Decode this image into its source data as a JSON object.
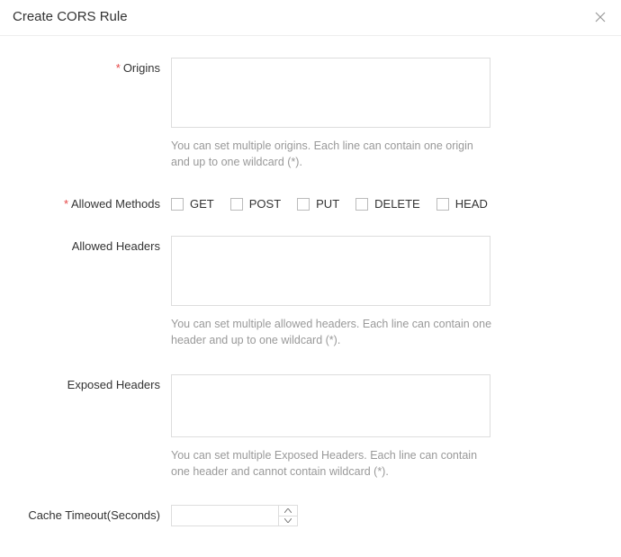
{
  "dialog": {
    "title": "Create CORS Rule"
  },
  "fields": {
    "origins": {
      "label": "Origins",
      "required": true,
      "value": "",
      "hint": "You can set multiple origins. Each line can contain one origin and up to one wildcard (*)."
    },
    "allowedMethods": {
      "label": "Allowed Methods",
      "required": true,
      "options": [
        {
          "label": "GET",
          "checked": false
        },
        {
          "label": "POST",
          "checked": false
        },
        {
          "label": "PUT",
          "checked": false
        },
        {
          "label": "DELETE",
          "checked": false
        },
        {
          "label": "HEAD",
          "checked": false
        }
      ]
    },
    "allowedHeaders": {
      "label": "Allowed Headers",
      "required": false,
      "value": "",
      "hint": "You can set multiple allowed headers. Each line can contain one header and up to one wildcard (*)."
    },
    "exposedHeaders": {
      "label": "Exposed Headers",
      "required": false,
      "value": "",
      "hint": "You can set multiple Exposed Headers. Each line can contain one header and cannot contain wildcard (*)."
    },
    "cacheTimeout": {
      "label": "Cache Timeout(Seconds)",
      "required": false,
      "value": ""
    }
  }
}
